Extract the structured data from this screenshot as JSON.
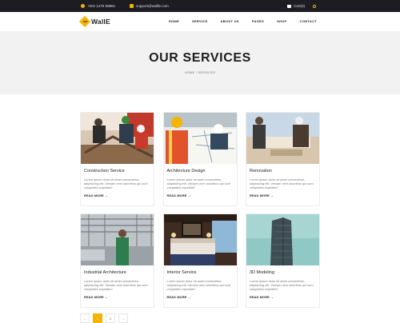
{
  "topbar": {
    "phone": "+001 1278 59881",
    "email": "support@wallle.com",
    "cart": "Cart(0)"
  },
  "brand": {
    "name": "WallE"
  },
  "nav": {
    "items": [
      "HOME",
      "SERVICE",
      "ABOUT US",
      "PAGES",
      "SHOP",
      "CONTACT"
    ]
  },
  "hero": {
    "title": "OUR SERVICES",
    "breadcrumb": "HOME / SERVICES"
  },
  "services": [
    {
      "title": "Construction Service",
      "text": "Lorem ipsum dolor sit amet consectetur, adipisicing elit. Veniam nem doloribus qui cum voluptates expedita?",
      "more": "READ MORE →",
      "image": "construction-workers-photo"
    },
    {
      "title": "Architecture Design",
      "text": "Lorem ipsum dolor sit amet consectetur, adipisicing elit. Veniam nem doloribus qui cum voluptates expedita?",
      "more": "READ MORE →",
      "image": "architect-blueprint-photo"
    },
    {
      "title": "Renovation",
      "text": "Lorem ipsum dolor sit amet consectetur, adipisicing elit. Veniam nem doloribus qui cum voluptates expedita?",
      "more": "READ MORE →",
      "image": "renovation-workers-photo"
    },
    {
      "title": "Industrial Architecture",
      "text": "Lorem ipsum dolor sit amet consectetur, adipisicing elit. Veniam nem doloribus qui cum voluptates expedita?",
      "more": "READ MORE →",
      "image": "industrial-warehouse-photo"
    },
    {
      "title": "Interior Service",
      "text": "Lorem ipsum dolor sit amet consectetur, adipisicing elit. Veniam nem doloribus qui cum voluptates expedita?",
      "more": "READ MORE →",
      "image": "hotel-bedroom-photo"
    },
    {
      "title": "3D Modeling",
      "text": "Lorem ipsum dolor sit amet consectetur, adipisicing elit. Veniam nem doloribus qui cum voluptates expedita?",
      "more": "READ MORE →",
      "image": "skyscraper-photo"
    }
  ],
  "pagination": {
    "pages": [
      "←",
      "1",
      "2",
      "→"
    ],
    "active": "1"
  },
  "colors": {
    "accent": "#f5b400",
    "topbar": "#1c1c22",
    "hero_bg": "#f2f2f2"
  }
}
